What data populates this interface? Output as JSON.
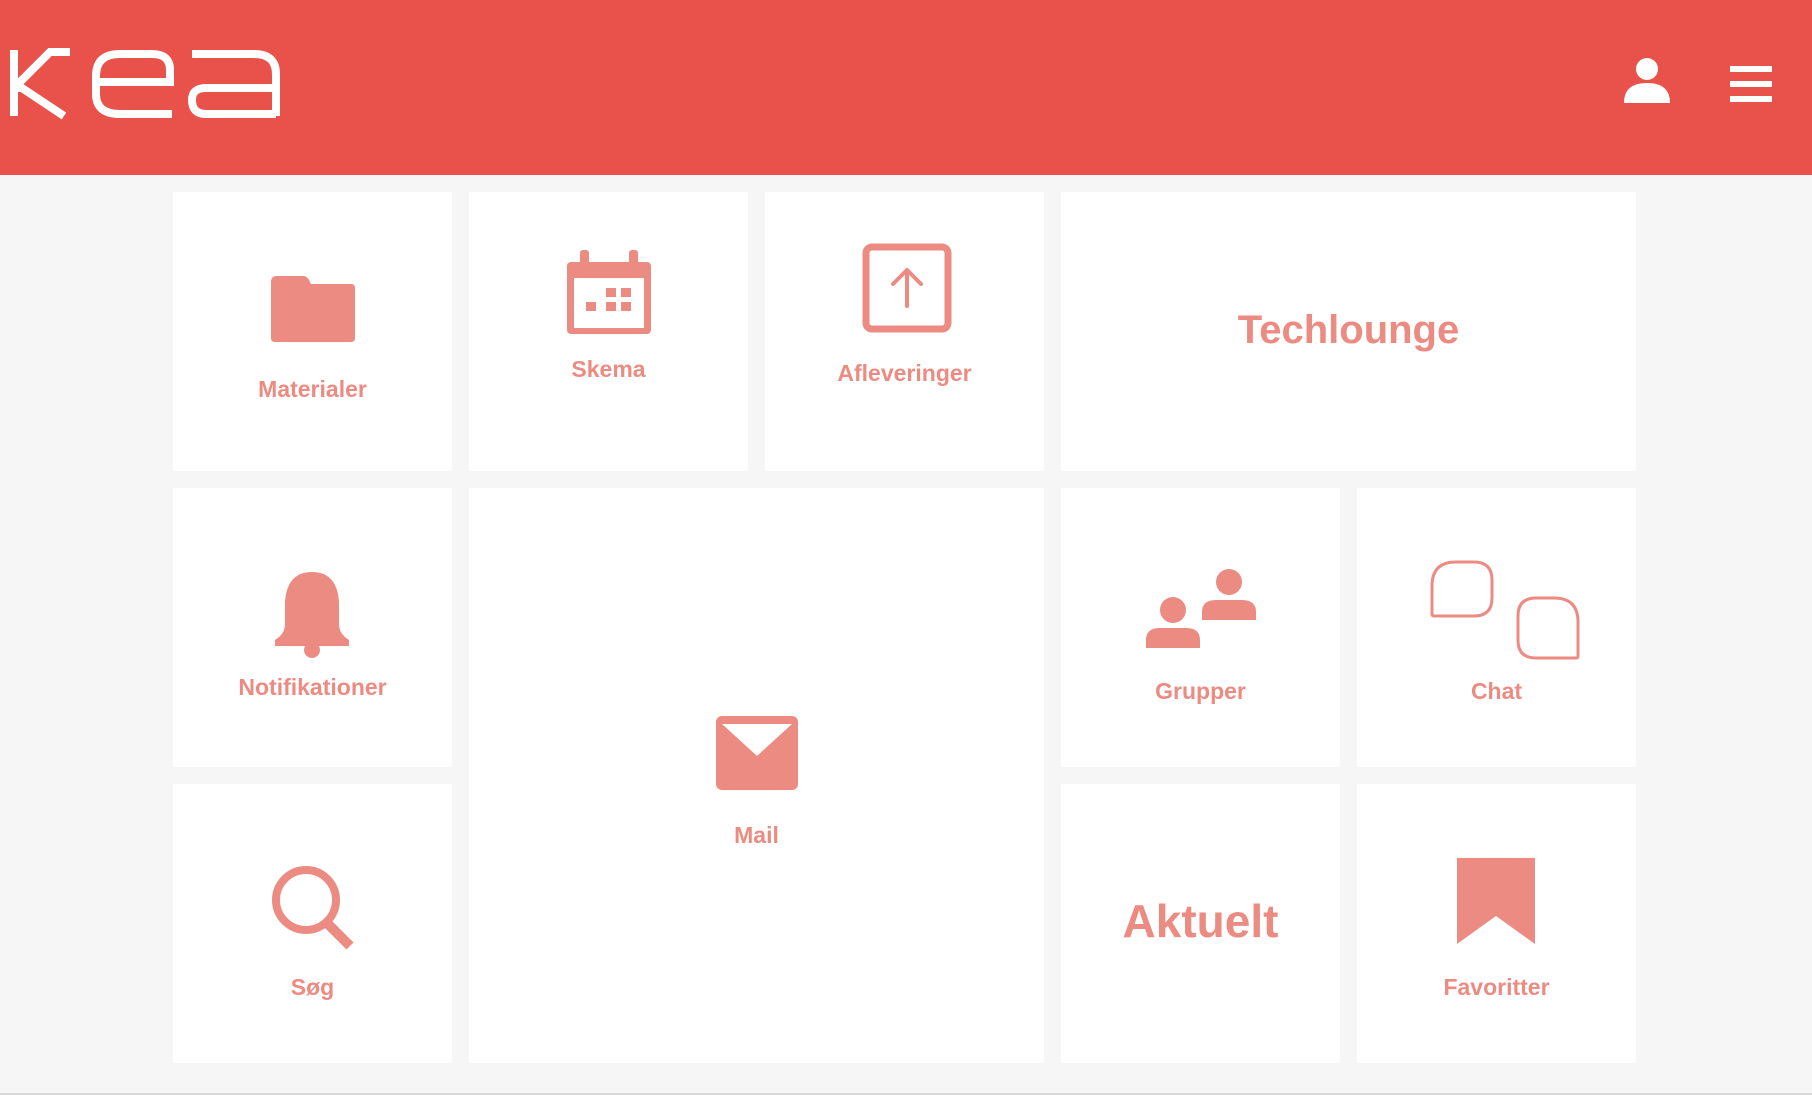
{
  "header": {
    "logo_text": "kea",
    "background_color": "#e9524a",
    "user_icon": "user-icon",
    "menu_icon": "hamburger-menu-icon"
  },
  "accent_color": "#ec8b82",
  "tiles": {
    "materialer": {
      "label": "Materialer",
      "icon": "folder-icon"
    },
    "skema": {
      "label": "Skema",
      "icon": "calendar-icon"
    },
    "afleveringer": {
      "label": "Afleveringer",
      "icon": "upload-icon"
    },
    "techlounge": {
      "label": "Techlounge"
    },
    "notifikationer": {
      "label": "Notifikationer",
      "icon": "bell-icon"
    },
    "mail": {
      "label": "Mail",
      "icon": "envelope-icon"
    },
    "grupper": {
      "label": "Grupper",
      "icon": "group-icon"
    },
    "chat": {
      "label": "Chat",
      "icon": "chat-bubbles-icon"
    },
    "soeg": {
      "label": "Søg",
      "icon": "search-icon"
    },
    "aktuelt": {
      "label": "Aktuelt"
    },
    "favoritter": {
      "label": "Favoritter",
      "icon": "bookmark-icon"
    }
  }
}
